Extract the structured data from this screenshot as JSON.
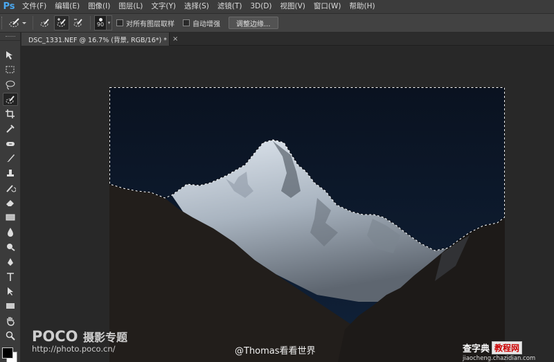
{
  "app": {
    "logo": "Ps",
    "menu": [
      "文件(F)",
      "编辑(E)",
      "图像(I)",
      "图层(L)",
      "文字(Y)",
      "选择(S)",
      "滤镜(T)",
      "3D(D)",
      "视图(V)",
      "窗口(W)",
      "帮助(H)"
    ]
  },
  "options": {
    "brush_size": "90",
    "sample_all_layers_label": "对所有图层取样",
    "auto_enhance_label": "自动增强",
    "refine_edge_label": "调整边缘..."
  },
  "tools": [
    "move-icon",
    "marquee-icon",
    "lasso-icon",
    "quick-selection-icon",
    "crop-icon",
    "eyedropper-icon",
    "healing-brush-icon",
    "brush-icon",
    "clone-stamp-icon",
    "history-brush-icon",
    "eraser-icon",
    "gradient-icon",
    "blur-icon",
    "dodge-icon",
    "pen-icon",
    "type-icon",
    "path-selection-icon",
    "rectangle-icon",
    "hand-icon",
    "zoom-icon"
  ],
  "active_tool": "quick-selection-icon",
  "colors": {
    "foreground": "#000000",
    "background": "#ffffff",
    "sky": "#0d1726",
    "ps_blue": "#4aa8f0"
  },
  "document": {
    "tab_title": "DSC_1331.NEF @ 16.7% (背景, RGB/16*) *",
    "close_glyph": "×"
  },
  "watermark": {
    "brand": "POCO",
    "title": "摄影专题",
    "url": "http://photo.poco.cn/",
    "author": "@Thomas看看世界",
    "site_name": "查字典",
    "site_badge": "教程网",
    "site_url": "jiaocheng.chazidian.com"
  }
}
